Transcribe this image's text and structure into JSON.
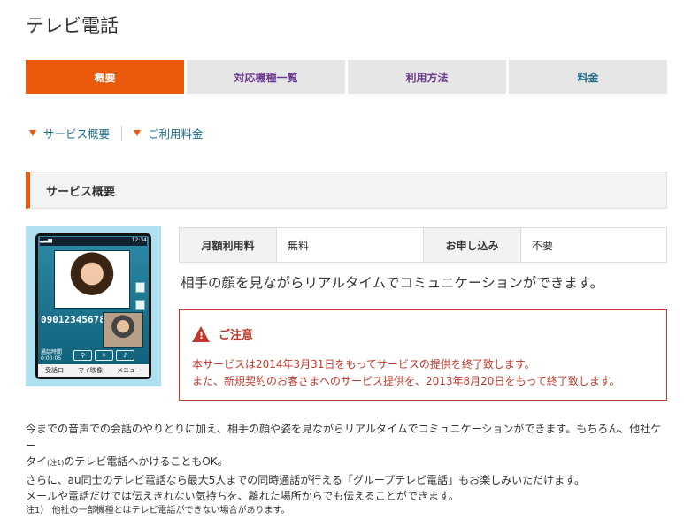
{
  "page": {
    "title": "テレビ電話"
  },
  "tabs": [
    {
      "label": "概要"
    },
    {
      "label": "対応機種一覧"
    },
    {
      "label": "利用方法"
    },
    {
      "label": "料金"
    }
  ],
  "anchors": [
    {
      "label": "サービス概要"
    },
    {
      "label": "ご利用料金"
    }
  ],
  "section": {
    "title": "サービス概要"
  },
  "phone": {
    "status_time": "12:34",
    "number": "09012345678",
    "call_time_label": "通話時間",
    "call_time": "0:00:05",
    "soft_left": "受話口",
    "soft_center": "マイ映像",
    "soft_right": "メニュー"
  },
  "info": {
    "monthly_label": "月額利用料",
    "monthly_value": "無料",
    "apply_label": "お申し込み",
    "apply_value": "不要"
  },
  "lead": "相手の顔を見ながらリアルタイムでコミュニケーションができます。",
  "notice": {
    "title": "ご注意",
    "line1": "本サービスは2014年3月31日をもってサービスの提供を終了致します。",
    "line2": "また、新規契約のお客さまへのサービス提供を、2013年8月20日をもって終了致します。"
  },
  "body": {
    "line1": "今までの音声での会話のやりとりに加え、相手の顔や姿を見ながらリアルタイムでコミュニケーションができます。もちろん、他社ケー",
    "line2a": "タイ",
    "line2_note": "(注1)",
    "line2b": "のテレビ電話へかけることもOK。",
    "line3": "さらに、au同士のテレビ電話なら最大5人までの同時通話が行える「グループテレビ電話」もお楽しみいただけます。",
    "line4": "メールや電話だけでは伝えきれない気持ちを、離れた場所からでも伝えることができます。"
  },
  "footnote": "注1） 他社の一部機種とはテレビ電話ができない場合があります。",
  "colors": {
    "accent": "#eb5a0a",
    "warning": "#c0392b",
    "link": "#1e6d8a"
  }
}
